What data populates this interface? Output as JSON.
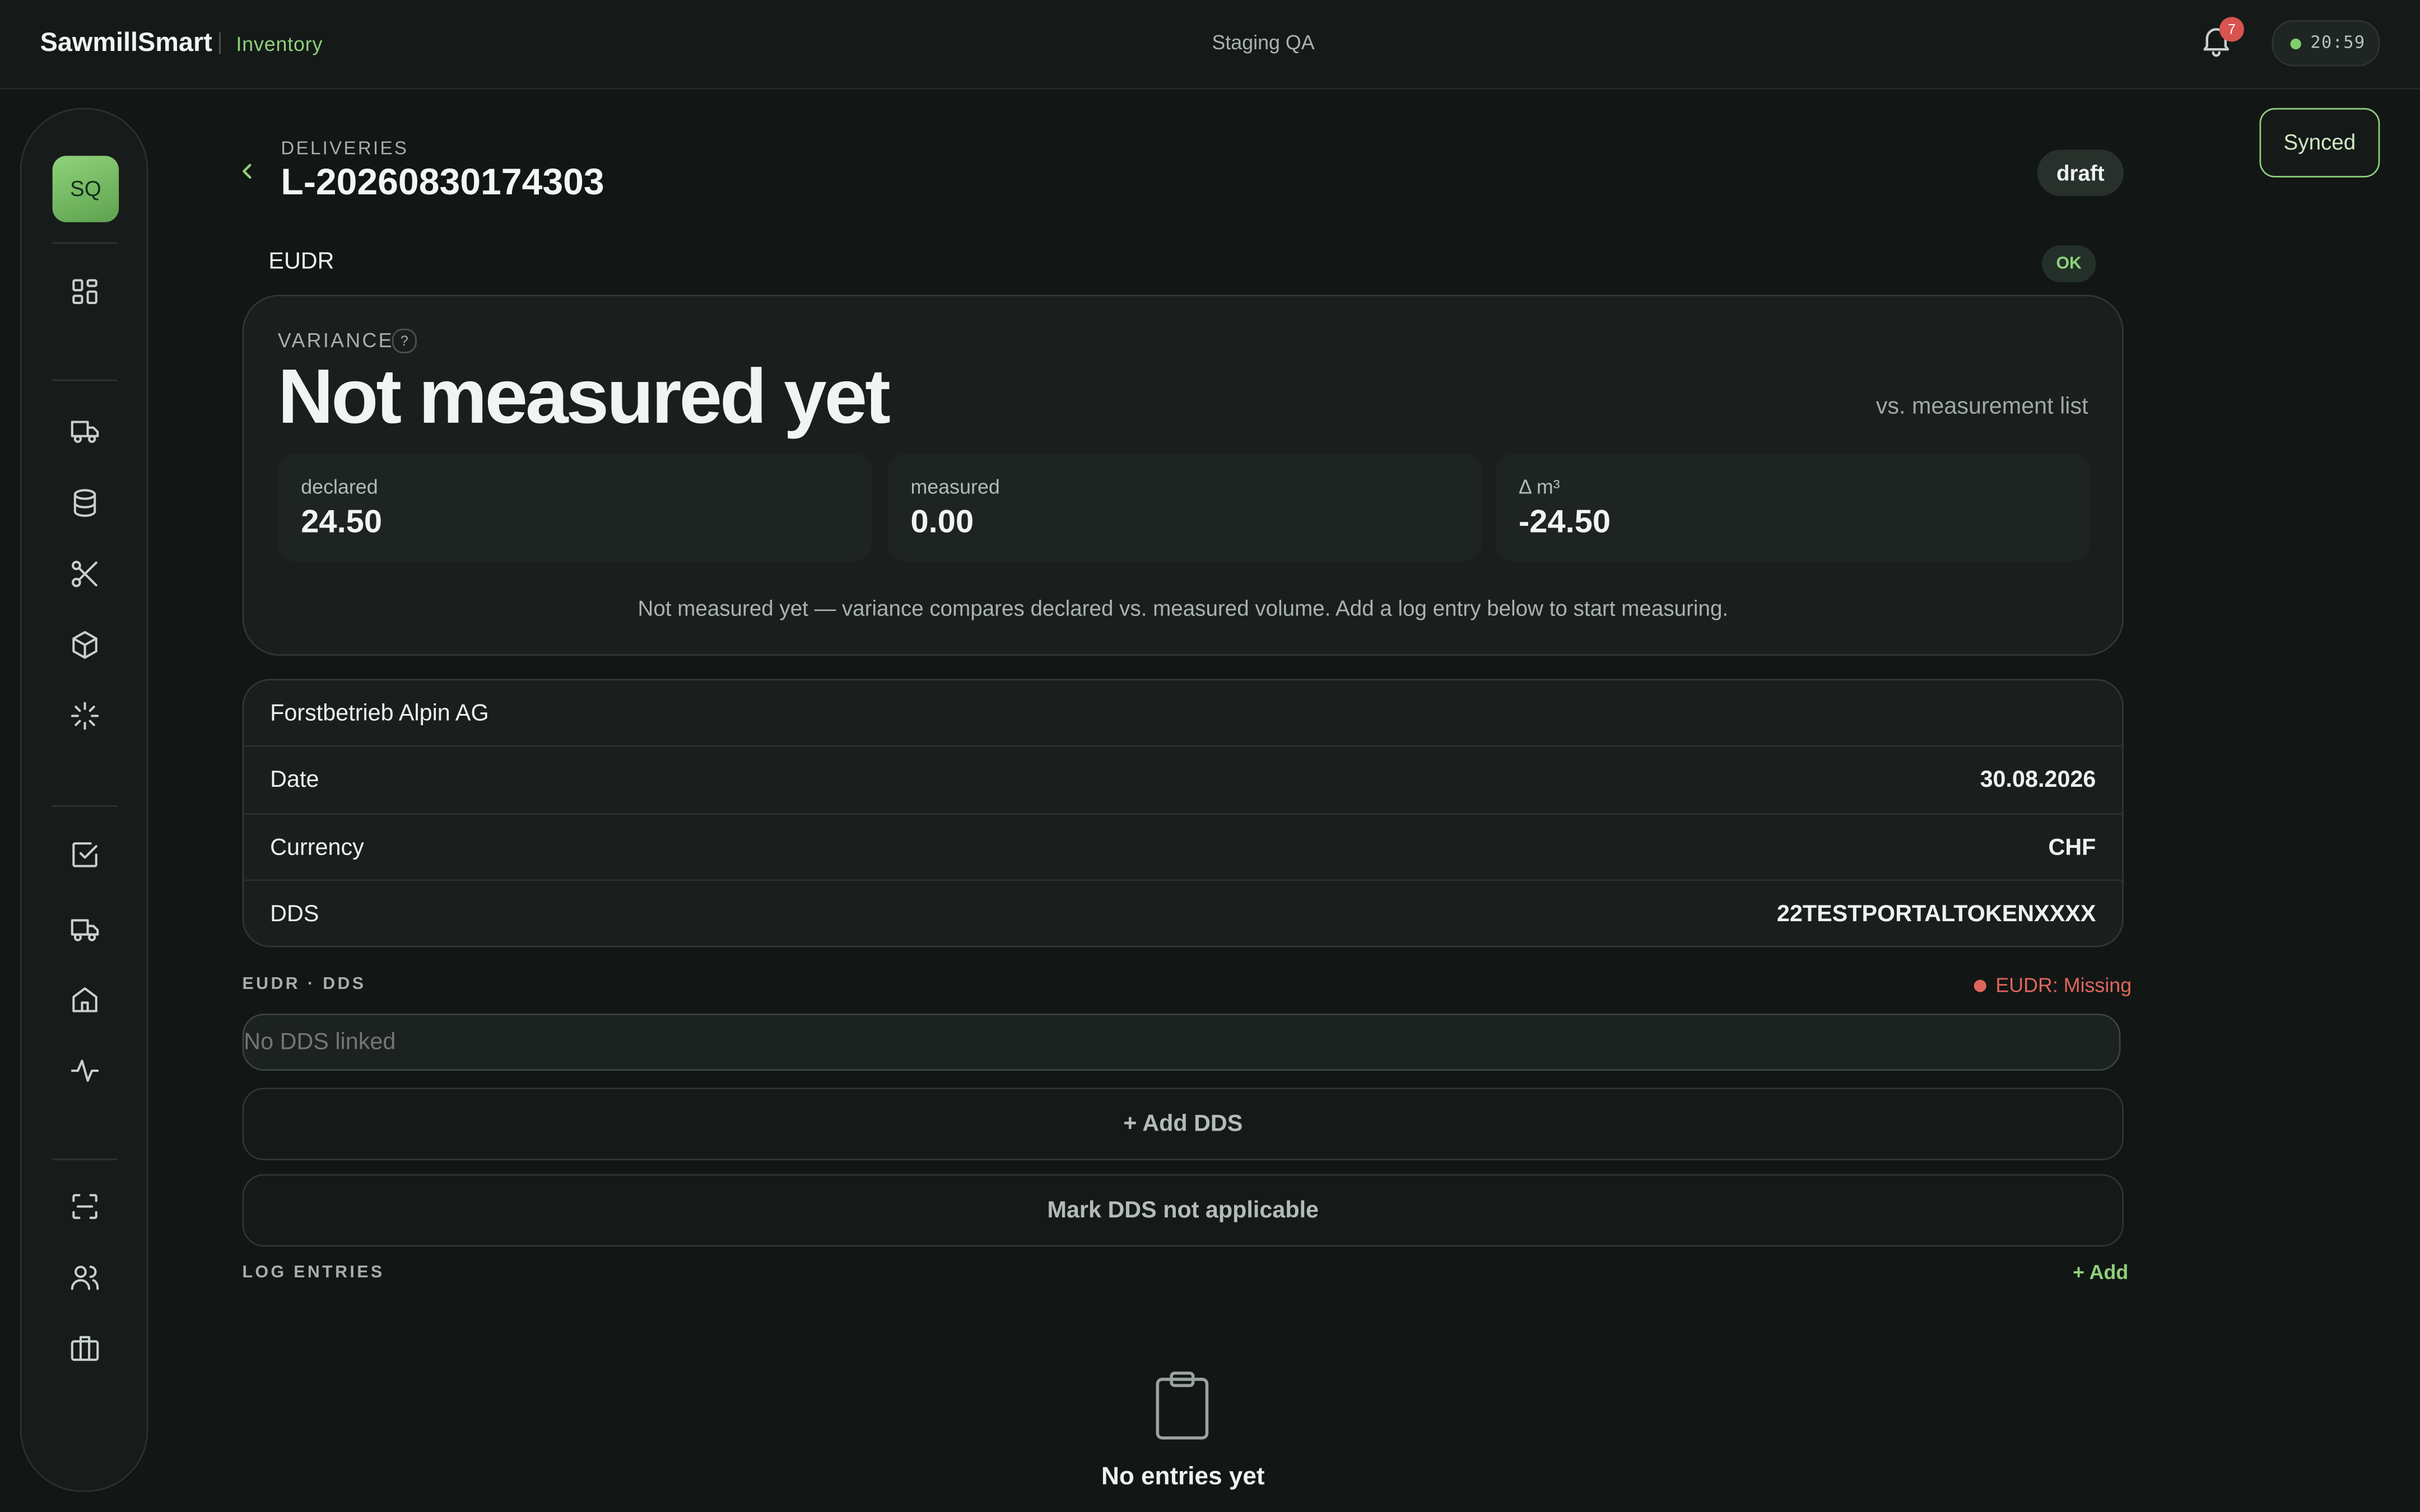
{
  "app": {
    "brand": "SawmillSmart",
    "section": "Inventory",
    "environment": "Staging QA"
  },
  "header": {
    "notification_count": "7",
    "clock": "20:59",
    "sync_status": "Synced"
  },
  "user": {
    "initials": "SQ"
  },
  "page": {
    "breadcrumb": "DELIVERIES",
    "title": "L-20260830174303",
    "status": "draft"
  },
  "eudr": {
    "label": "EUDR",
    "status": "OK"
  },
  "variance": {
    "label": "VARIANCE",
    "help": "?",
    "headline": "Not measured yet",
    "comparison": "vs. measurement list",
    "declared_label": "declared",
    "declared_value": "24.50",
    "measured_label": "measured",
    "measured_value": "0.00",
    "delta_label": "Δ m³",
    "delta_value": "-24.50",
    "note": "Not measured yet — variance compares declared vs. measured volume. Add a log entry below to start measuring."
  },
  "details": {
    "supplier": "Forstbetrieb Alpin AG",
    "rows": [
      {
        "key": "Date",
        "value": "30.08.2026"
      },
      {
        "key": "Currency",
        "value": "CHF"
      },
      {
        "key": "DDS",
        "value": "22TESTPORTALTOKENXXXX"
      }
    ]
  },
  "dds": {
    "section_label": "EUDR · DDS",
    "status": "EUDR: Missing",
    "placeholder": "No DDS linked",
    "add_button": "+ Add DDS",
    "not_applicable_button": "Mark DDS not applicable"
  },
  "log_entries": {
    "section_label": "LOG ENTRIES",
    "add_label": "+ Add",
    "empty_text": "No entries yet"
  },
  "colors": {
    "accent": "#8fcf7a",
    "danger": "#e0665c",
    "background": "#121614"
  }
}
